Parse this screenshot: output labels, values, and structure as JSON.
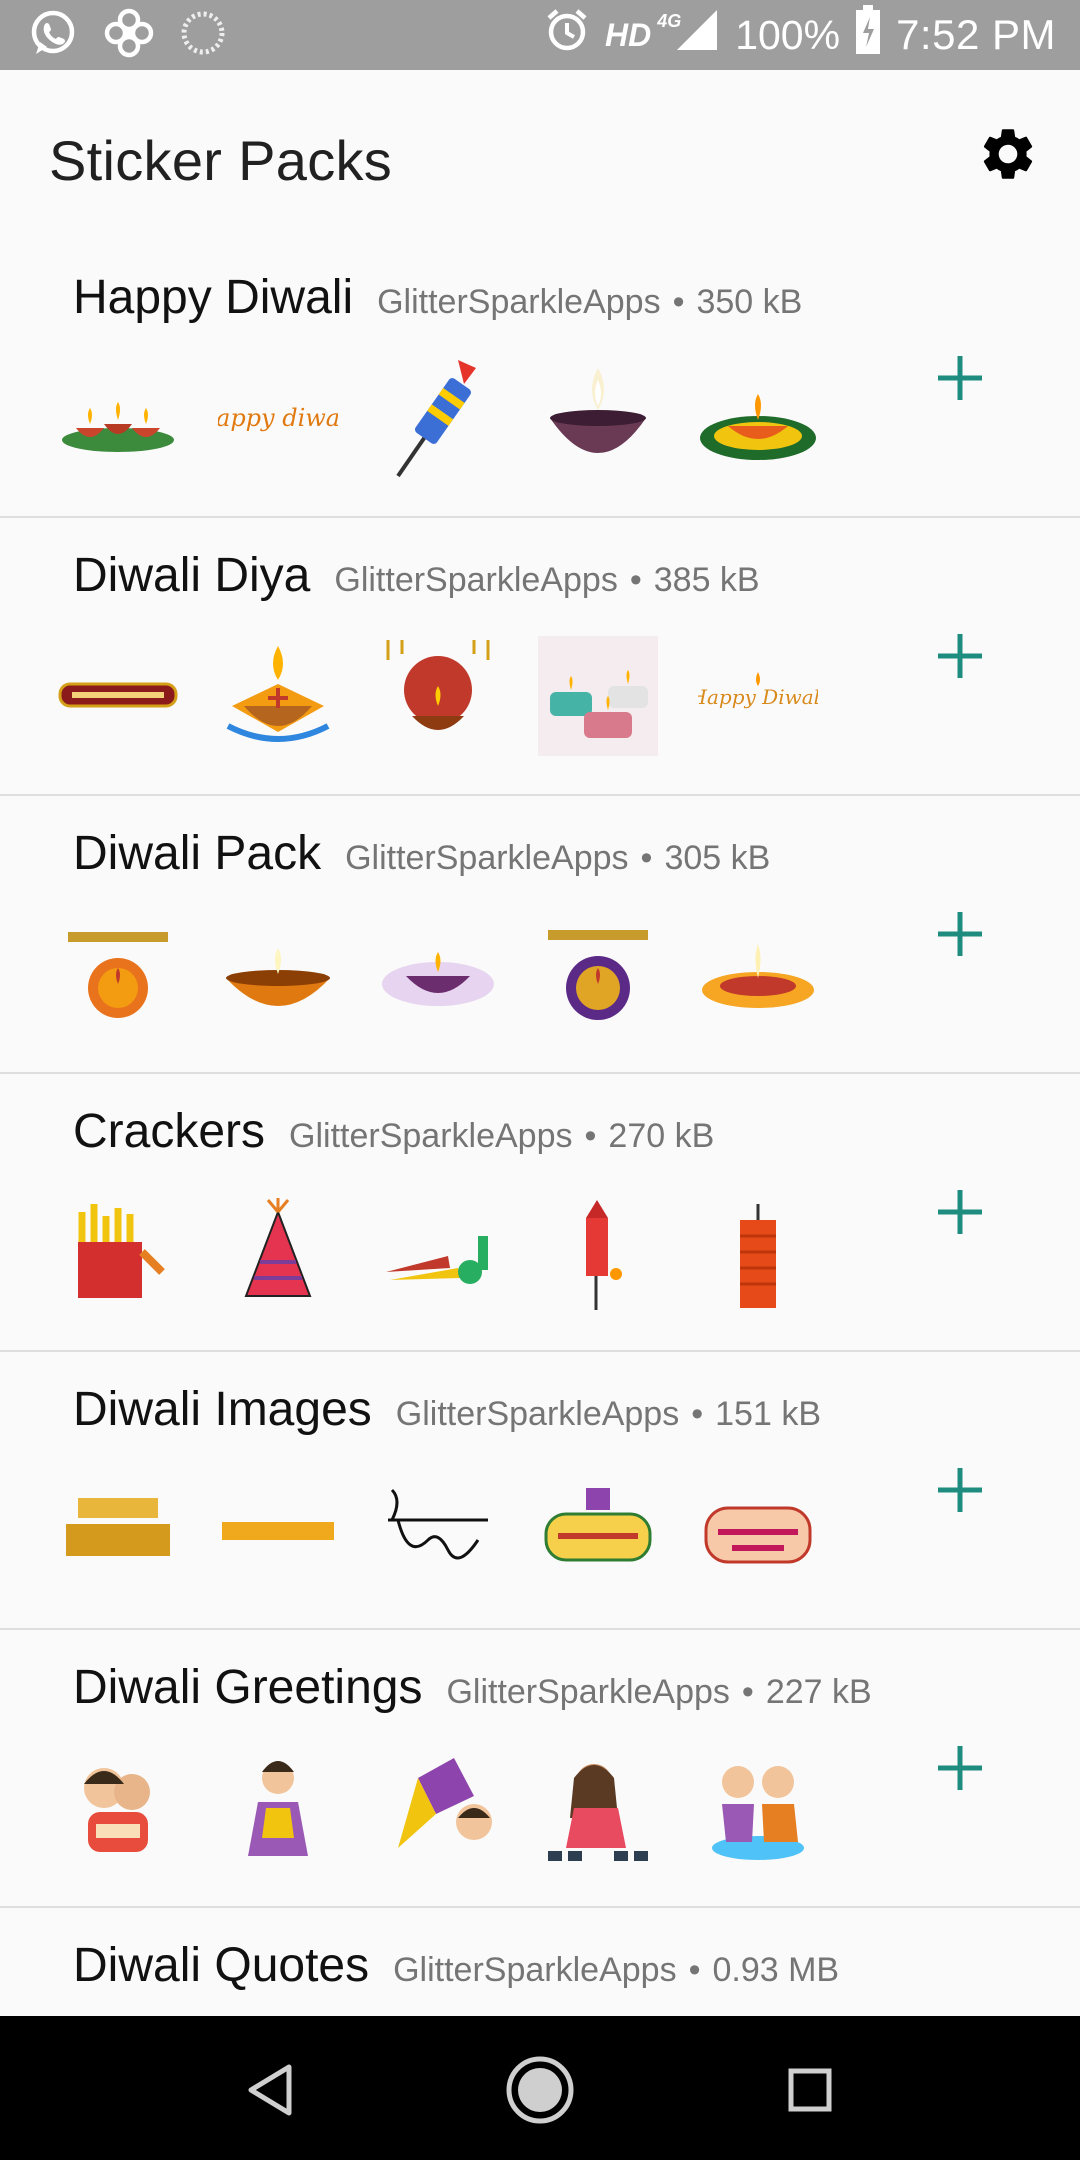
{
  "status_bar": {
    "left_icons": [
      "whatsapp-icon",
      "app-icon",
      "sync-icon"
    ],
    "hd_label": "HD",
    "network_label": "4G",
    "battery": "100%",
    "time": "7:52 PM"
  },
  "app_bar": {
    "title": "Sticker Packs",
    "settings_icon": "gear-icon"
  },
  "packs": [
    {
      "name": "Happy Diwali",
      "publisher": "GlitterSparkleApps",
      "size": "350 kB",
      "stickers": [
        "diya-trio",
        "happy-diwali-text",
        "rocket-cracker",
        "clay-diya",
        "rangoli-diya"
      ]
    },
    {
      "name": "Diwali Diya",
      "publisher": "GlitterSparkleApps",
      "size": "385 kB",
      "stickers": [
        "tamil-diwali-banner",
        "swastik-diya",
        "lantern-diya",
        "teal-candles",
        "happy-diwali-script"
      ]
    },
    {
      "name": "Diwali Pack",
      "publisher": "GlitterSparkleApps",
      "size": "305 kB",
      "stickers": [
        "happy-diwali-badge",
        "bowl-diya",
        "purple-diya",
        "happy-diwali-medallion",
        "flower-diya"
      ]
    },
    {
      "name": "Crackers",
      "publisher": "GlitterSparkleApps",
      "size": "270 kB",
      "stickers": [
        "cracker-box",
        "cone-fountain",
        "rocket-set",
        "red-rocket",
        "cracker-string"
      ]
    },
    {
      "name": "Diwali Images",
      "publisher": "GlitterSparkleApps",
      "size": "151 kB",
      "stickers": [
        "happy-diwali-gold",
        "happy-diwali-banner",
        "hindi-calligraphy",
        "bonuswali-diwali",
        "taashwali-diwali"
      ]
    },
    {
      "name": "Diwali Greetings",
      "publisher": "GlitterSparkleApps",
      "size": "227 kB",
      "stickers": [
        "kids-happy-diwali",
        "girl-diya",
        "rocket-kid",
        "girl-diyas",
        "kids-rangoli"
      ]
    },
    {
      "name": "Diwali Quotes",
      "publisher": "GlitterSparkleApps",
      "size": "0.93 MB",
      "stickers": []
    }
  ],
  "nav_bar": {
    "back_icon": "back-triangle-icon",
    "home_icon": "home-circle-icon",
    "recents_icon": "recents-square-icon"
  },
  "colors": {
    "accent": "#1e8c7e",
    "status_bar": "#9e9e9e",
    "divider": "#dedede"
  }
}
